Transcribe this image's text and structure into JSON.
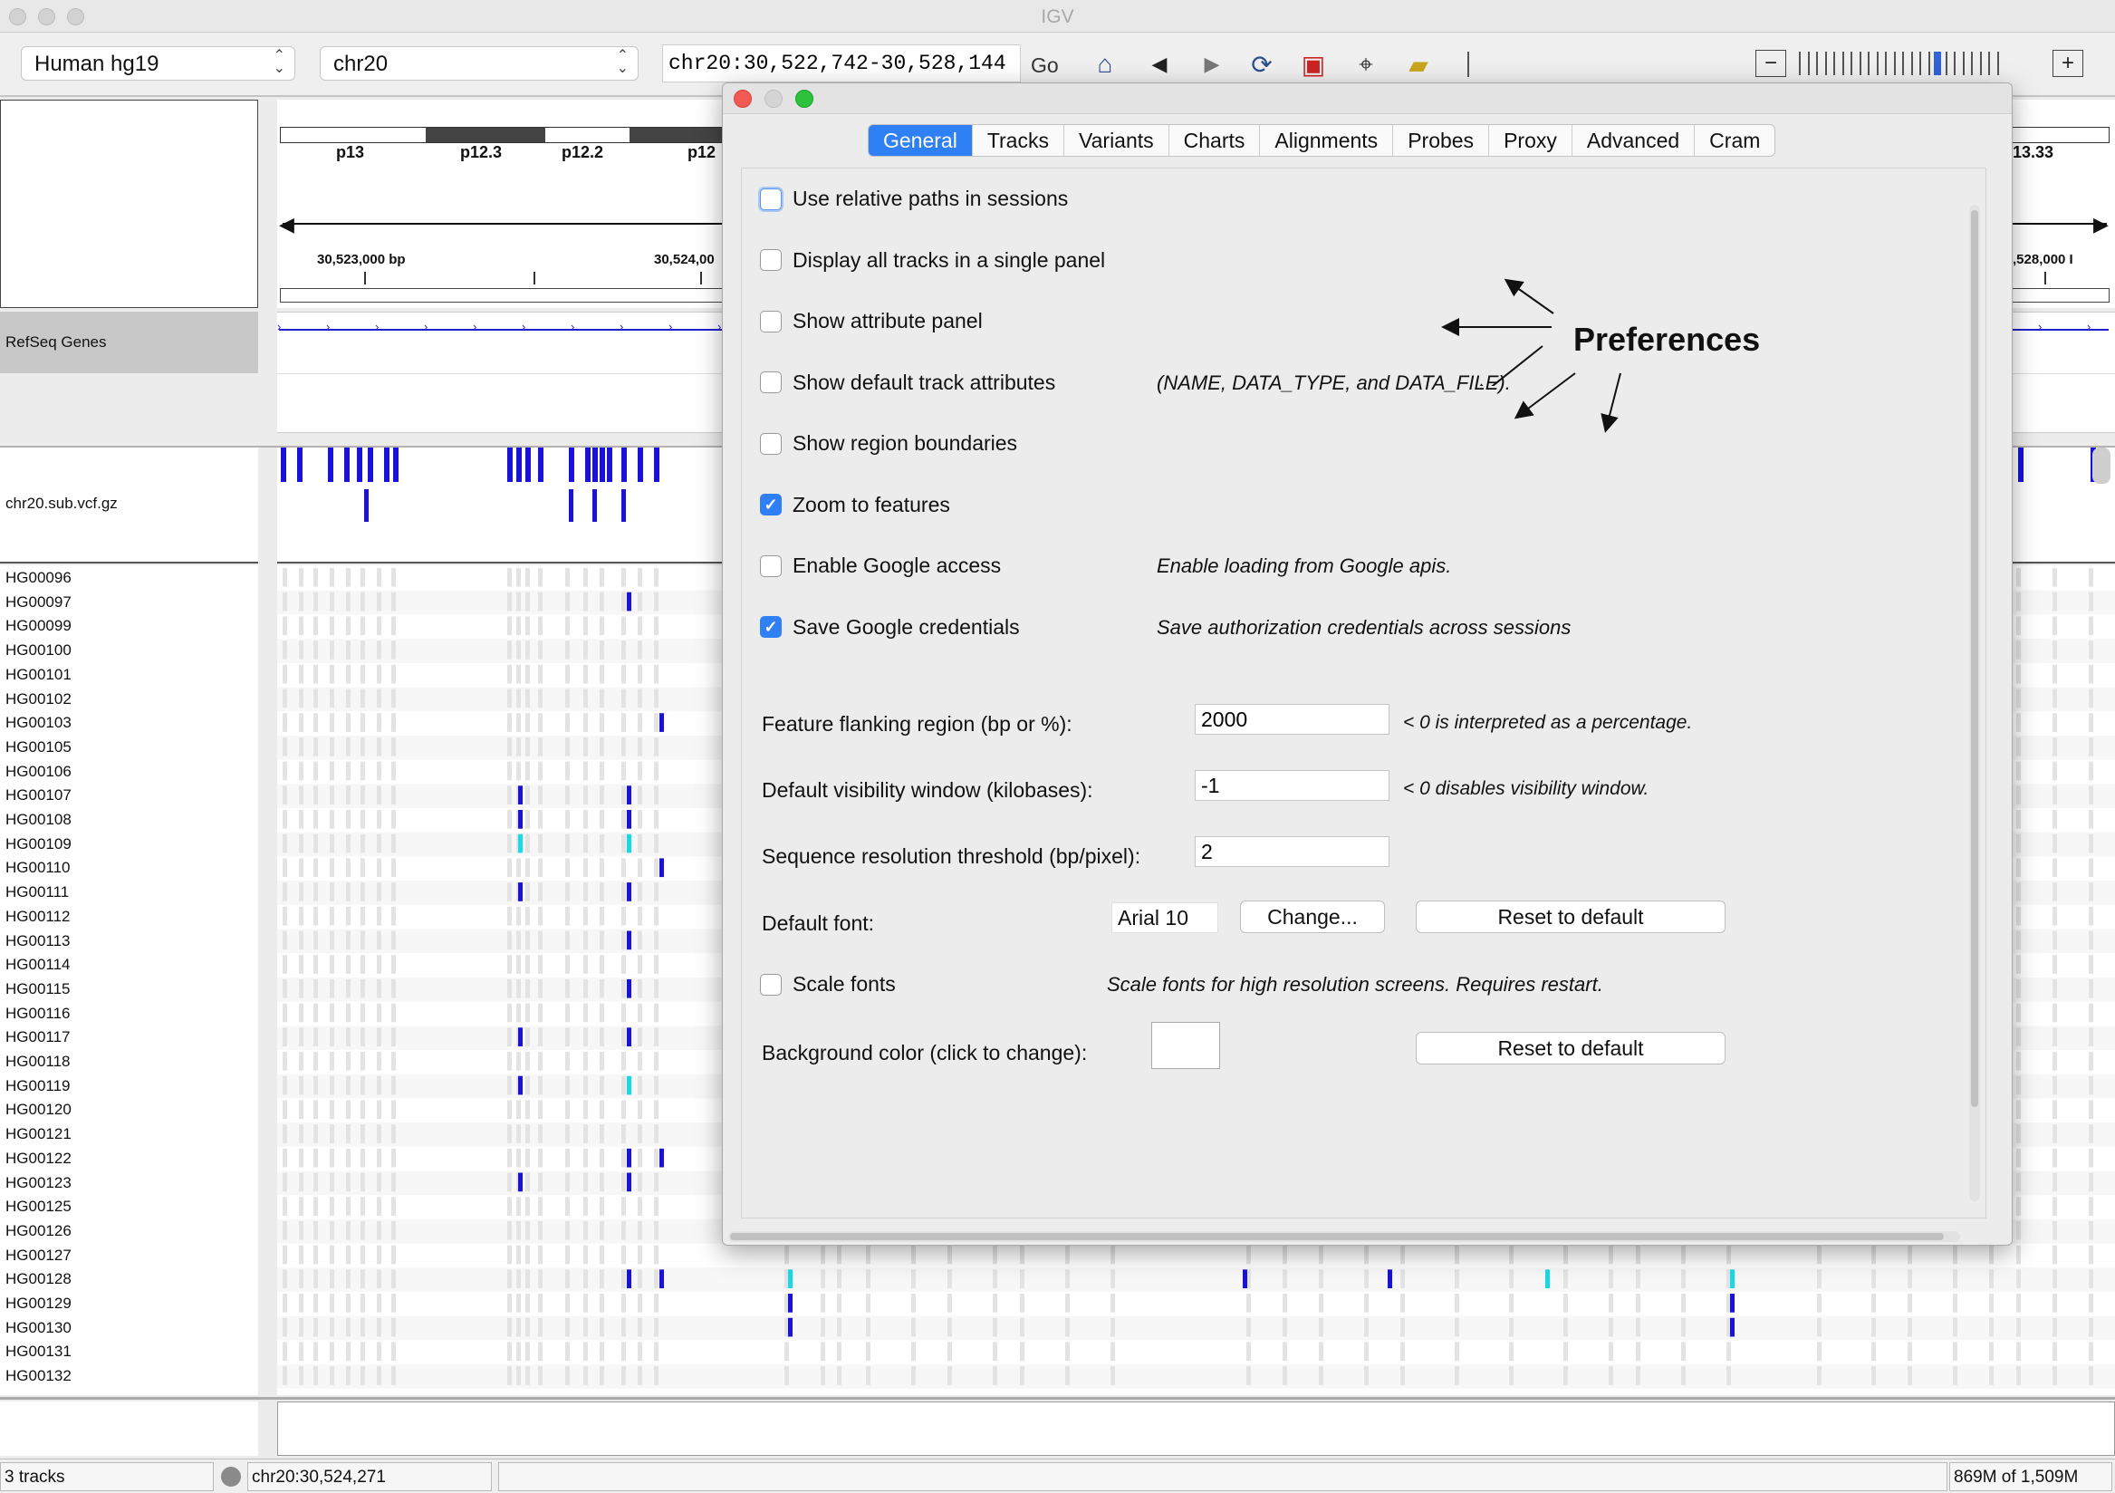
{
  "app": {
    "title": "IGV"
  },
  "toolbar": {
    "genome": "Human hg19",
    "chromosome": "chr20",
    "locus": "chr20:30,522,742-30,528,144",
    "go_label": "Go",
    "icons": [
      "home-icon",
      "back-icon",
      "forward-icon",
      "refresh-icon",
      "roi-icon",
      "resize-icon",
      "popup-text-icon"
    ],
    "zoom_minus": "−",
    "zoom_plus": "+",
    "zoom_level": 0.7
  },
  "ideogram": {
    "bands": [
      "p13",
      "p12.3",
      "p12.2",
      "p12"
    ],
    "right_band": "13.33",
    "ruler_left": "30,523,000 bp",
    "ruler_mid": "30,524,00",
    "ruler_right": ",528,000 I"
  },
  "tracks": {
    "refseq_label": "RefSeq Genes",
    "vcf_label": "chr20.sub.vcf.gz",
    "samples": [
      "HG00096",
      "HG00097",
      "HG00099",
      "HG00100",
      "HG00101",
      "HG00102",
      "HG00103",
      "HG00105",
      "HG00106",
      "HG00107",
      "HG00108",
      "HG00109",
      "HG00110",
      "HG00111",
      "HG00112",
      "HG00113",
      "HG00114",
      "HG00115",
      "HG00116",
      "HG00117",
      "HG00118",
      "HG00119",
      "HG00120",
      "HG00121",
      "HG00122",
      "HG00123",
      "HG00125",
      "HG00126",
      "HG00127",
      "HG00128",
      "HG00129",
      "HG00130",
      "HG00131",
      "HG00132"
    ]
  },
  "dialog": {
    "tabs": [
      {
        "label": "General",
        "active": true
      },
      {
        "label": "Tracks",
        "active": false
      },
      {
        "label": "Variants",
        "active": false
      },
      {
        "label": "Charts",
        "active": false
      },
      {
        "label": "Alignments",
        "active": false
      },
      {
        "label": "Probes",
        "active": false
      },
      {
        "label": "Proxy",
        "active": false
      },
      {
        "label": "Advanced",
        "active": false
      },
      {
        "label": "Cram",
        "active": false
      }
    ],
    "annotation": "Preferences",
    "checkboxes": [
      {
        "label": "Use relative paths in sessions",
        "checked": false,
        "note": ""
      },
      {
        "label": "Display all tracks in a single panel",
        "checked": false,
        "note": ""
      },
      {
        "label": "Show attribute panel",
        "checked": false,
        "note": ""
      },
      {
        "label": "Show default track attributes",
        "checked": false,
        "note": "(NAME, DATA_TYPE, and DATA_FILE)."
      },
      {
        "label": "Show region boundaries",
        "checked": false,
        "note": ""
      },
      {
        "label": "Zoom to features",
        "checked": true,
        "note": ""
      },
      {
        "label": "Enable Google access",
        "checked": false,
        "note": "Enable loading from Google apis."
      },
      {
        "label": "Save Google credentials",
        "checked": true,
        "note": "Save authorization credentials across sessions"
      }
    ],
    "fields": [
      {
        "label": "Feature flanking region (bp or %):",
        "value": "2000",
        "note": "< 0 is interpreted as a percentage."
      },
      {
        "label": "Default visibility window (kilobases):",
        "value": "-1",
        "note": "< 0 disables visibility window."
      },
      {
        "label": "Sequence resolution threshold (bp/pixel):",
        "value": "2",
        "note": ""
      }
    ],
    "font": {
      "label": "Default font:",
      "value": "Arial 10",
      "change": "Change...",
      "reset": "Reset to default"
    },
    "scale_fonts": {
      "label": "Scale fonts",
      "checked": false,
      "note": "Scale fonts for high resolution screens. Requires restart."
    },
    "background": {
      "label": "Background color (click to change):",
      "reset": "Reset to default",
      "color": "#ffffff"
    }
  },
  "status": {
    "tracks": "3 tracks",
    "position": "chr20:30,524,271",
    "memory": "869M of 1,509M"
  },
  "colors": {
    "accent": "#2f7ff5",
    "variant": "#1a12d6",
    "variant_alt": "#19d9e6"
  }
}
